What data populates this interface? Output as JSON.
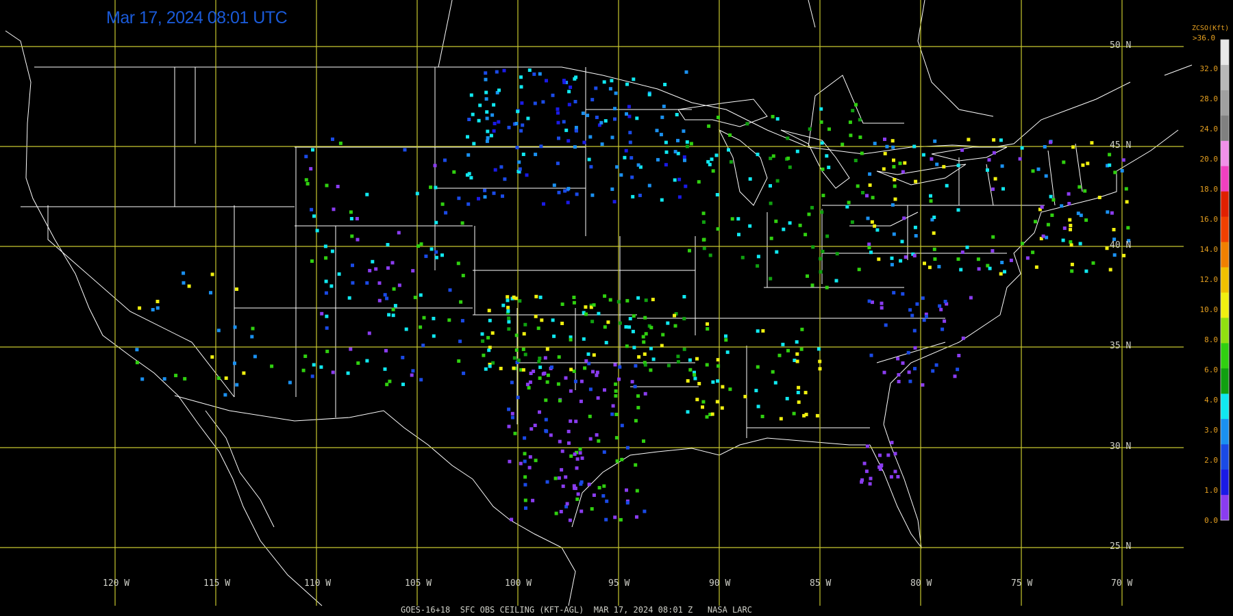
{
  "timestamp": "Mar 17, 2024 08:01 UTC",
  "footer": "GOES-16+18  SFC OBS CEILING (KFT-AGL)  MAR 17, 2024 08:01 Z   NASA LARC",
  "latitude_labels": [
    "50 N",
    "45 N",
    "40 N",
    "35 N",
    "30 N",
    "25 N"
  ],
  "longitude_labels": [
    "120 W",
    "115 W",
    "110 W",
    "105 W",
    "100 W",
    "95 W",
    "90 W",
    "85 W",
    "80 W",
    "75 W",
    "70 W"
  ],
  "legend": {
    "title": "ZCSO(Kft)",
    "top_label": ">36.0",
    "ticks": [
      "32.0",
      "28.0",
      "24.0",
      "20.0",
      "18.0",
      "16.0",
      "14.0",
      "12.0",
      "10.0",
      "8.0",
      "6.0",
      "4.0",
      "3.0",
      "2.0",
      "1.0",
      "0.0"
    ],
    "colors": [
      "#8a3cf0",
      "#1a1ae6",
      "#1a4ae6",
      "#1a90f0",
      "#10e8f0",
      "#10a010",
      "#30d010",
      "#90e010",
      "#f0f010",
      "#f0c000",
      "#f08000",
      "#f04000",
      "#e02000",
      "#f040c0",
      "#f090e8",
      "#808080",
      "#a0a0a0",
      "#b8b8b8",
      "#e8e8e8"
    ],
    "accent_color": "#e6a020"
  },
  "colors": {
    "grid": "#c8c830",
    "borders": "#ffffff",
    "background": "#000000",
    "timestamp": "#1a5ad8"
  }
}
